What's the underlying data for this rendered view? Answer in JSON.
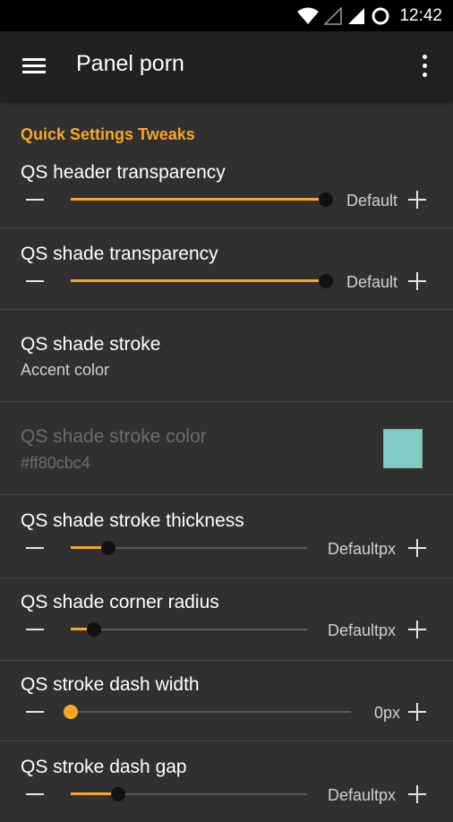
{
  "status_bar": {
    "time": "12:42"
  },
  "app_bar": {
    "title": "Panel porn"
  },
  "section": {
    "title": "Quick Settings Tweaks"
  },
  "prefs": [
    {
      "title": "QS header transparency",
      "value_label": "Default",
      "slider_fraction": 1.0,
      "thumb": "dark"
    },
    {
      "title": "QS shade transparency",
      "value_label": "Default",
      "slider_fraction": 1.0,
      "thumb": "dark"
    },
    {
      "title": "QS shade stroke",
      "summary": "Accent color"
    },
    {
      "title": "QS shade stroke color",
      "summary": "#ff80cbc4",
      "enabled": false,
      "swatch_color": "#80cbc4"
    },
    {
      "title": "QS shade stroke thickness",
      "value_label": "Defaultpx",
      "slider_fraction": 0.16,
      "thumb": "dark"
    },
    {
      "title": "QS shade corner radius",
      "value_label": "Defaultpx",
      "slider_fraction": 0.1,
      "thumb": "dark"
    },
    {
      "title": "QS stroke dash width",
      "value_label": "0px",
      "slider_fraction": 0.0,
      "thumb": "accent"
    },
    {
      "title": "QS stroke dash gap",
      "value_label": "Defaultpx",
      "slider_fraction": 0.2,
      "thumb": "dark"
    }
  ],
  "colors": {
    "accent": "#f9a825",
    "background": "#303030",
    "app_bar": "#212121",
    "swatch": "#80cbc4"
  },
  "icons": {
    "menu": "menu-icon",
    "overflow": "more-vert-icon",
    "wifi": "wifi-icon",
    "signal": "signal-icon",
    "battery": "battery-charging-icon",
    "minus": "minus-icon",
    "plus": "plus-icon"
  }
}
